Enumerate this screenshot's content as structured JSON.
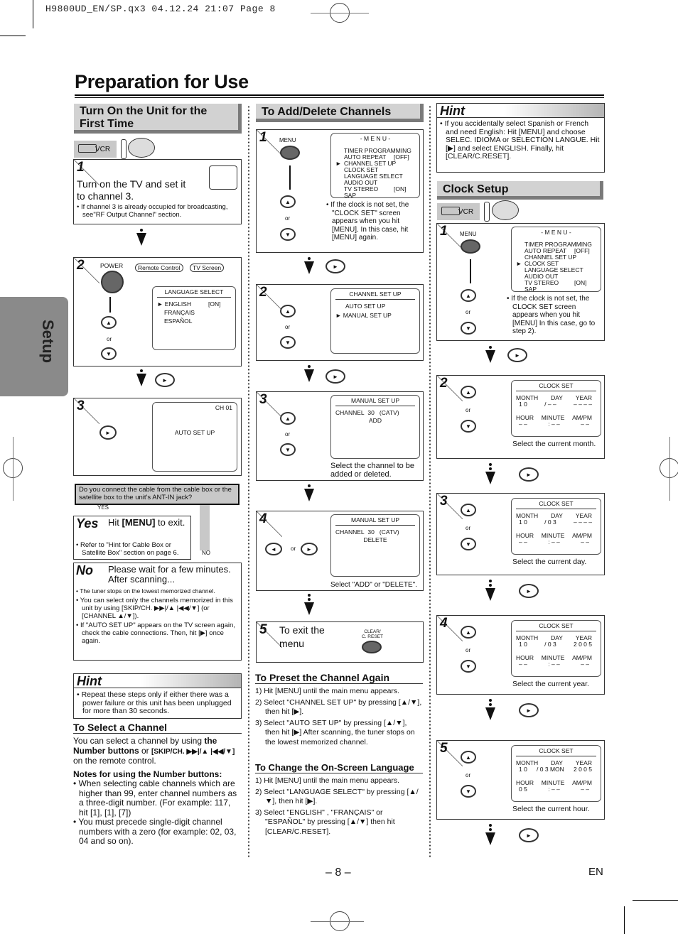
{
  "slug": "H9800UD_EN/SP.qx3  04.12.24 21:07  Page 8",
  "page_title": "Preparation for Use",
  "side_tab": "Setup",
  "page_number": "– 8 –",
  "lang_code": "EN",
  "col1": {
    "section_title_line1": "Turn On the Unit for the",
    "section_title_line2": "First Time",
    "mode_icon_label": "VCR",
    "step1": {
      "num": "1",
      "text_line1": "Turn on the TV and set it",
      "text_line2": "to channel 3.",
      "note": "If channel 3 is already occupied for broadcasting, see\"RF Output Channel\" section."
    },
    "step2": {
      "num": "2",
      "power_label": "POWER",
      "bubble_remote": "Remote Control",
      "bubble_tv": "TV Screen",
      "or": "or",
      "screen": {
        "header": "LANGUAGE SELECT",
        "items": [
          {
            "label": "ENGLISH",
            "value": "[ON]",
            "selected": true
          },
          {
            "label": "FRANÇAIS",
            "value": "",
            "selected": false
          },
          {
            "label": "ESPAÑOL",
            "value": "",
            "selected": false
          }
        ]
      }
    },
    "step3": {
      "num": "3",
      "screen_channel": "CH 01",
      "screen_text": "AUTO SET UP"
    },
    "question": "Do you connect the cable from the cable box or the satellite box to the unit's ANT-IN jack?",
    "yes_tag": "YES",
    "no_tag": "NO",
    "yes": {
      "label": "Yes",
      "text_pre": "Hit ",
      "text_bold": "[MENU]",
      "text_post": " to exit.",
      "note": "Refer to \"Hint for Cable Box or Satellite Box\" section on page 6."
    },
    "no": {
      "label": "No",
      "text_line1": "Please wait for a few minutes.",
      "text_line2": "After scanning...",
      "bullets": [
        "The tuner stops on the lowest memorized channel.",
        "You can select only the channels memorized in this unit by using [SKIP/CH. ▶▶|/▲ |◀◀/▼] (or [CHANNEL ▲/▼]).",
        "If \"AUTO SET UP\" appears on the TV screen again, check the cable connections. Then, hit [▶] once again."
      ]
    },
    "hint": {
      "title": "Hint",
      "text": "Repeat these steps only if either there was a power failure or this unit has been unplugged for more than 30 seconds."
    },
    "select_channel": {
      "title": "To Select a Channel",
      "p1_pre": "You can select a channel by using ",
      "p1_bold": "the Number buttons",
      "p1_mid": " or ",
      "p1_bold2": "[SKIP/CH. ▶▶|/▲ |◀◀/▼]",
      "p1_post": " on the remote control.",
      "notes_title": "Notes for using the Number buttons:",
      "notes": [
        "When selecting cable channels which are higher than 99, enter channel numbers as a three-digit number. (For example: 117, hit [1], [1], [7])",
        "You must precede single-digit channel numbers with a zero (for example: 02, 03, 04 and so on)."
      ]
    }
  },
  "col2": {
    "section_title": "To Add/Delete Channels",
    "step1": {
      "num": "1",
      "button_label": "MENU",
      "or": "or",
      "screen": {
        "header": "- M E N U -",
        "items": [
          {
            "label": "TIMER PROGRAMMING",
            "value": "",
            "selected": false
          },
          {
            "label": "AUTO REPEAT",
            "value": "[OFF]",
            "selected": false
          },
          {
            "label": "CHANNEL SET UP",
            "value": "",
            "selected": true
          },
          {
            "label": "CLOCK SET",
            "value": "",
            "selected": false
          },
          {
            "label": "LANGUAGE SELECT",
            "value": "",
            "selected": false
          },
          {
            "label": "AUDIO OUT",
            "value": "",
            "selected": false
          },
          {
            "label": "TV STEREO",
            "value": "[ON]",
            "selected": false
          },
          {
            "label": "SAP",
            "value": "",
            "selected": false
          }
        ]
      },
      "note": "If the clock is not set, the \"CLOCK SET\" screen appears when you hit [MENU]. In this case, hit [MENU] again."
    },
    "step2": {
      "num": "2",
      "or": "or",
      "screen": {
        "header": "CHANNEL SET UP",
        "items": [
          {
            "label": "AUTO SET UP",
            "selected": false
          },
          {
            "label": "MANUAL SET UP",
            "selected": true
          }
        ]
      }
    },
    "step3": {
      "num": "3",
      "or": "or",
      "screen": {
        "header": "MANUAL SET UP",
        "channel_label": "CHANNEL",
        "channel_value": "30",
        "channel_type": "(CATV)",
        "status": "ADD"
      },
      "caption": "Select the channel to be added or deleted."
    },
    "step4": {
      "num": "4",
      "or": "or",
      "screen": {
        "header": "MANUAL SET UP",
        "channel_label": "CHANNEL",
        "channel_value": "30",
        "channel_type": "(CATV)",
        "status": "DELETE"
      },
      "caption": "Select \"ADD\" or \"DELETE\"."
    },
    "step5": {
      "num": "5",
      "text_line1": "To exit the",
      "text_line2": "menu",
      "button_label_line1": "CLEAR/",
      "button_label_line2": "C. RESET"
    },
    "preset": {
      "title": "To Preset the Channel Again",
      "steps": [
        "1) Hit [MENU] until the main menu appears.",
        "2) Select \"CHANNEL SET UP\" by pressing [▲/▼], then hit [▶].",
        "3) Select \"AUTO SET UP\" by pressing [▲/▼], then hit [▶] After scanning, the tuner stops on the lowest memorized channel."
      ]
    },
    "language": {
      "title": "To Change the On-Screen Language",
      "steps": [
        "1) Hit [MENU] until the main menu appears.",
        "2) Select \"LANGUAGE SELECT\" by pressing [▲/▼], then hit [▶].",
        "3) Select \"ENGLISH\" , \"FRANÇAIS\" or \"ESPAÑOL\" by pressing [▲/▼] then hit [CLEAR/C.RESET]."
      ]
    }
  },
  "col3": {
    "hint": {
      "title": "Hint",
      "text": "If you accidentally select Spanish or French and need English: Hit [MENU] and choose SELEC. IDIOMA or SELECTION LANGUE. Hit [▶] and select ENGLISH. Finally, hit [CLEAR/C.RESET]."
    },
    "section_title": "Clock Setup",
    "mode_icon_label": "VCR",
    "step1": {
      "num": "1",
      "button_label": "MENU",
      "or": "or",
      "screen": {
        "header": "- M E N U -",
        "items": [
          {
            "label": "TIMER PROGRAMMING",
            "value": "",
            "selected": false
          },
          {
            "label": "AUTO REPEAT",
            "value": "[OFF]",
            "selected": false
          },
          {
            "label": "CHANNEL SET UP",
            "value": "",
            "selected": false
          },
          {
            "label": "CLOCK SET",
            "value": "",
            "selected": true
          },
          {
            "label": "LANGUAGE SELECT",
            "value": "",
            "selected": false
          },
          {
            "label": "AUDIO OUT",
            "value": "",
            "selected": false
          },
          {
            "label": "TV STEREO",
            "value": "[ON]",
            "selected": false
          },
          {
            "label": "SAP",
            "value": "",
            "selected": false
          }
        ]
      },
      "note": "If the clock is not set, the CLOCK SET screen appears when you hit [MENU] In this case, go to step 2)."
    },
    "clock_steps": [
      {
        "num": "2",
        "or": "or",
        "header": "CLOCK SET",
        "row1_labels": [
          "MONTH",
          "DAY",
          "YEAR"
        ],
        "row1_values": [
          "1 0",
          "/ – –",
          "– – – –"
        ],
        "row2_labels": [
          "HOUR",
          "MINUTE",
          "AM/PM"
        ],
        "row2_values": [
          "– –",
          ": – –",
          "– –"
        ],
        "caption": "Select the current month."
      },
      {
        "num": "3",
        "or": "or",
        "header": "CLOCK SET",
        "row1_labels": [
          "MONTH",
          "DAY",
          "YEAR"
        ],
        "row1_values": [
          "1 0",
          "/ 0 3",
          "– – – –"
        ],
        "row2_labels": [
          "HOUR",
          "MINUTE",
          "AM/PM"
        ],
        "row2_values": [
          "– –",
          ": – –",
          "– –"
        ],
        "caption": "Select the current day."
      },
      {
        "num": "4",
        "or": "or",
        "header": "CLOCK SET",
        "row1_labels": [
          "MONTH",
          "DAY",
          "YEAR"
        ],
        "row1_values": [
          "1 0",
          "/ 0 3",
          "2 0 0 5"
        ],
        "row2_labels": [
          "HOUR",
          "MINUTE",
          "AM/PM"
        ],
        "row2_values": [
          "– –",
          ": – –",
          "– –"
        ],
        "caption": "Select the current year."
      },
      {
        "num": "5",
        "or": "or",
        "header": "CLOCK SET",
        "row1_labels": [
          "MONTH",
          "DAY",
          "YEAR"
        ],
        "row1_values": [
          "1 0",
          "/ 0 3 MON",
          "2 0 0 5"
        ],
        "row2_labels": [
          "HOUR",
          "MINUTE",
          "AM/PM"
        ],
        "row2_values": [
          "0 5",
          ": – –",
          "– –"
        ],
        "caption": "Select the current hour."
      }
    ]
  }
}
